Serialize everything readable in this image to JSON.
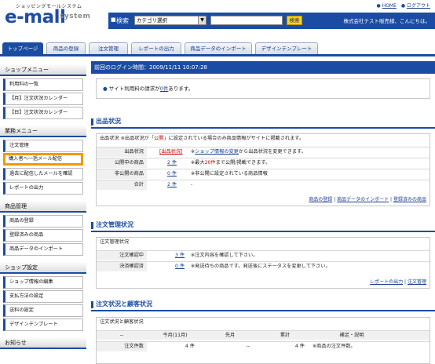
{
  "header": {
    "logo_small": "ショッピングモールシステム",
    "logo_main": "e-mall",
    "logo_sub": "system",
    "link_home": "HOME",
    "link_logout": "ログアウト",
    "search_label": "検索",
    "search_select": "カテゴリ選択",
    "search_input": "",
    "search_button": "検索",
    "user_message": "株式会社テスト販売様、こんにちは。"
  },
  "tabs": [
    "トップページ",
    "商品の登録",
    "注文管理",
    "レポートの出力",
    "商品データのインポート",
    "デザインテンプレート"
  ],
  "sidebar": {
    "shop_menu": {
      "title": "ショップメニュー",
      "items": [
        "利用料の一覧",
        "【月】注文状況カレンダー",
        "【日】注文状況カレンダー"
      ]
    },
    "work_menu": {
      "title": "業務メニュー",
      "items": [
        "注文管理",
        "購入者へ一括メール配信",
        "過去に配信したメールを確認",
        "レポートの出力"
      ]
    },
    "product_menu": {
      "title": "商品管理",
      "items": [
        "商品の登録",
        "登録済みの商品",
        "商品データのインポート"
      ]
    },
    "shop_settings": {
      "title": "ショップ設定",
      "items": [
        "ショップ情報の編集",
        "支払方法の設定",
        "送料の設定",
        "デザインテンプレート"
      ]
    },
    "news": {
      "title": "お知らせ"
    }
  },
  "main": {
    "last_login": "前回のログイン時間：2009/11/11 10:07:28",
    "notice_prefix": "サイト利用料の請求が",
    "notice_count": "0件",
    "notice_suffix": "あります。",
    "listing": {
      "title": "出品状況",
      "caption_a": "出品状況 ※出品状況が「",
      "caption_red": "公開",
      "caption_b": "」に設定されている場合のみ商品情報がサイトに掲載されます。",
      "rows": [
        {
          "label": "出品状況",
          "value": "[出品状況]",
          "note_a": "※",
          "note_link": "ショップ情報の変更",
          "note_b": "から出品状況を変更できます。"
        },
        {
          "label": "公開中の商品",
          "value": "2 件",
          "note_a": "※最大",
          "note_red": "20件",
          "note_b": "まで公開/掲載できます。"
        },
        {
          "label": "非公開の商品",
          "value": "0 件",
          "note_a": "※非公開に設定されている商品情報"
        },
        {
          "label": "合計",
          "value": "2 件",
          "note_a": "-"
        }
      ],
      "links": [
        "商品の登録",
        "商品データのインポート",
        "登録済みの商品"
      ]
    },
    "orders": {
      "title": "注文管理状況",
      "caption": "注文管理状況",
      "rows": [
        {
          "label": "注文確認中",
          "value": "3 件",
          "note": "※注文内容を確認して下さい。"
        },
        {
          "label": "決済確認済",
          "value": "0 件",
          "note": "※発送待ちの商品です。発送後にステータスを変更して下さい。"
        }
      ],
      "links": [
        "レポートの出力",
        "注文管理"
      ]
    },
    "customers": {
      "title": "注文状況と顧客状況",
      "caption": "注文状況と顧客状況",
      "headers": [
        "--",
        "今月(11月)",
        "先月",
        "累計",
        "補足・説明"
      ],
      "rows": [
        {
          "label": "注文件数",
          "this_month": "4 件",
          "last_month": "--",
          "total": "4 件",
          "note": "※商品の注文件数。"
        }
      ]
    }
  }
}
